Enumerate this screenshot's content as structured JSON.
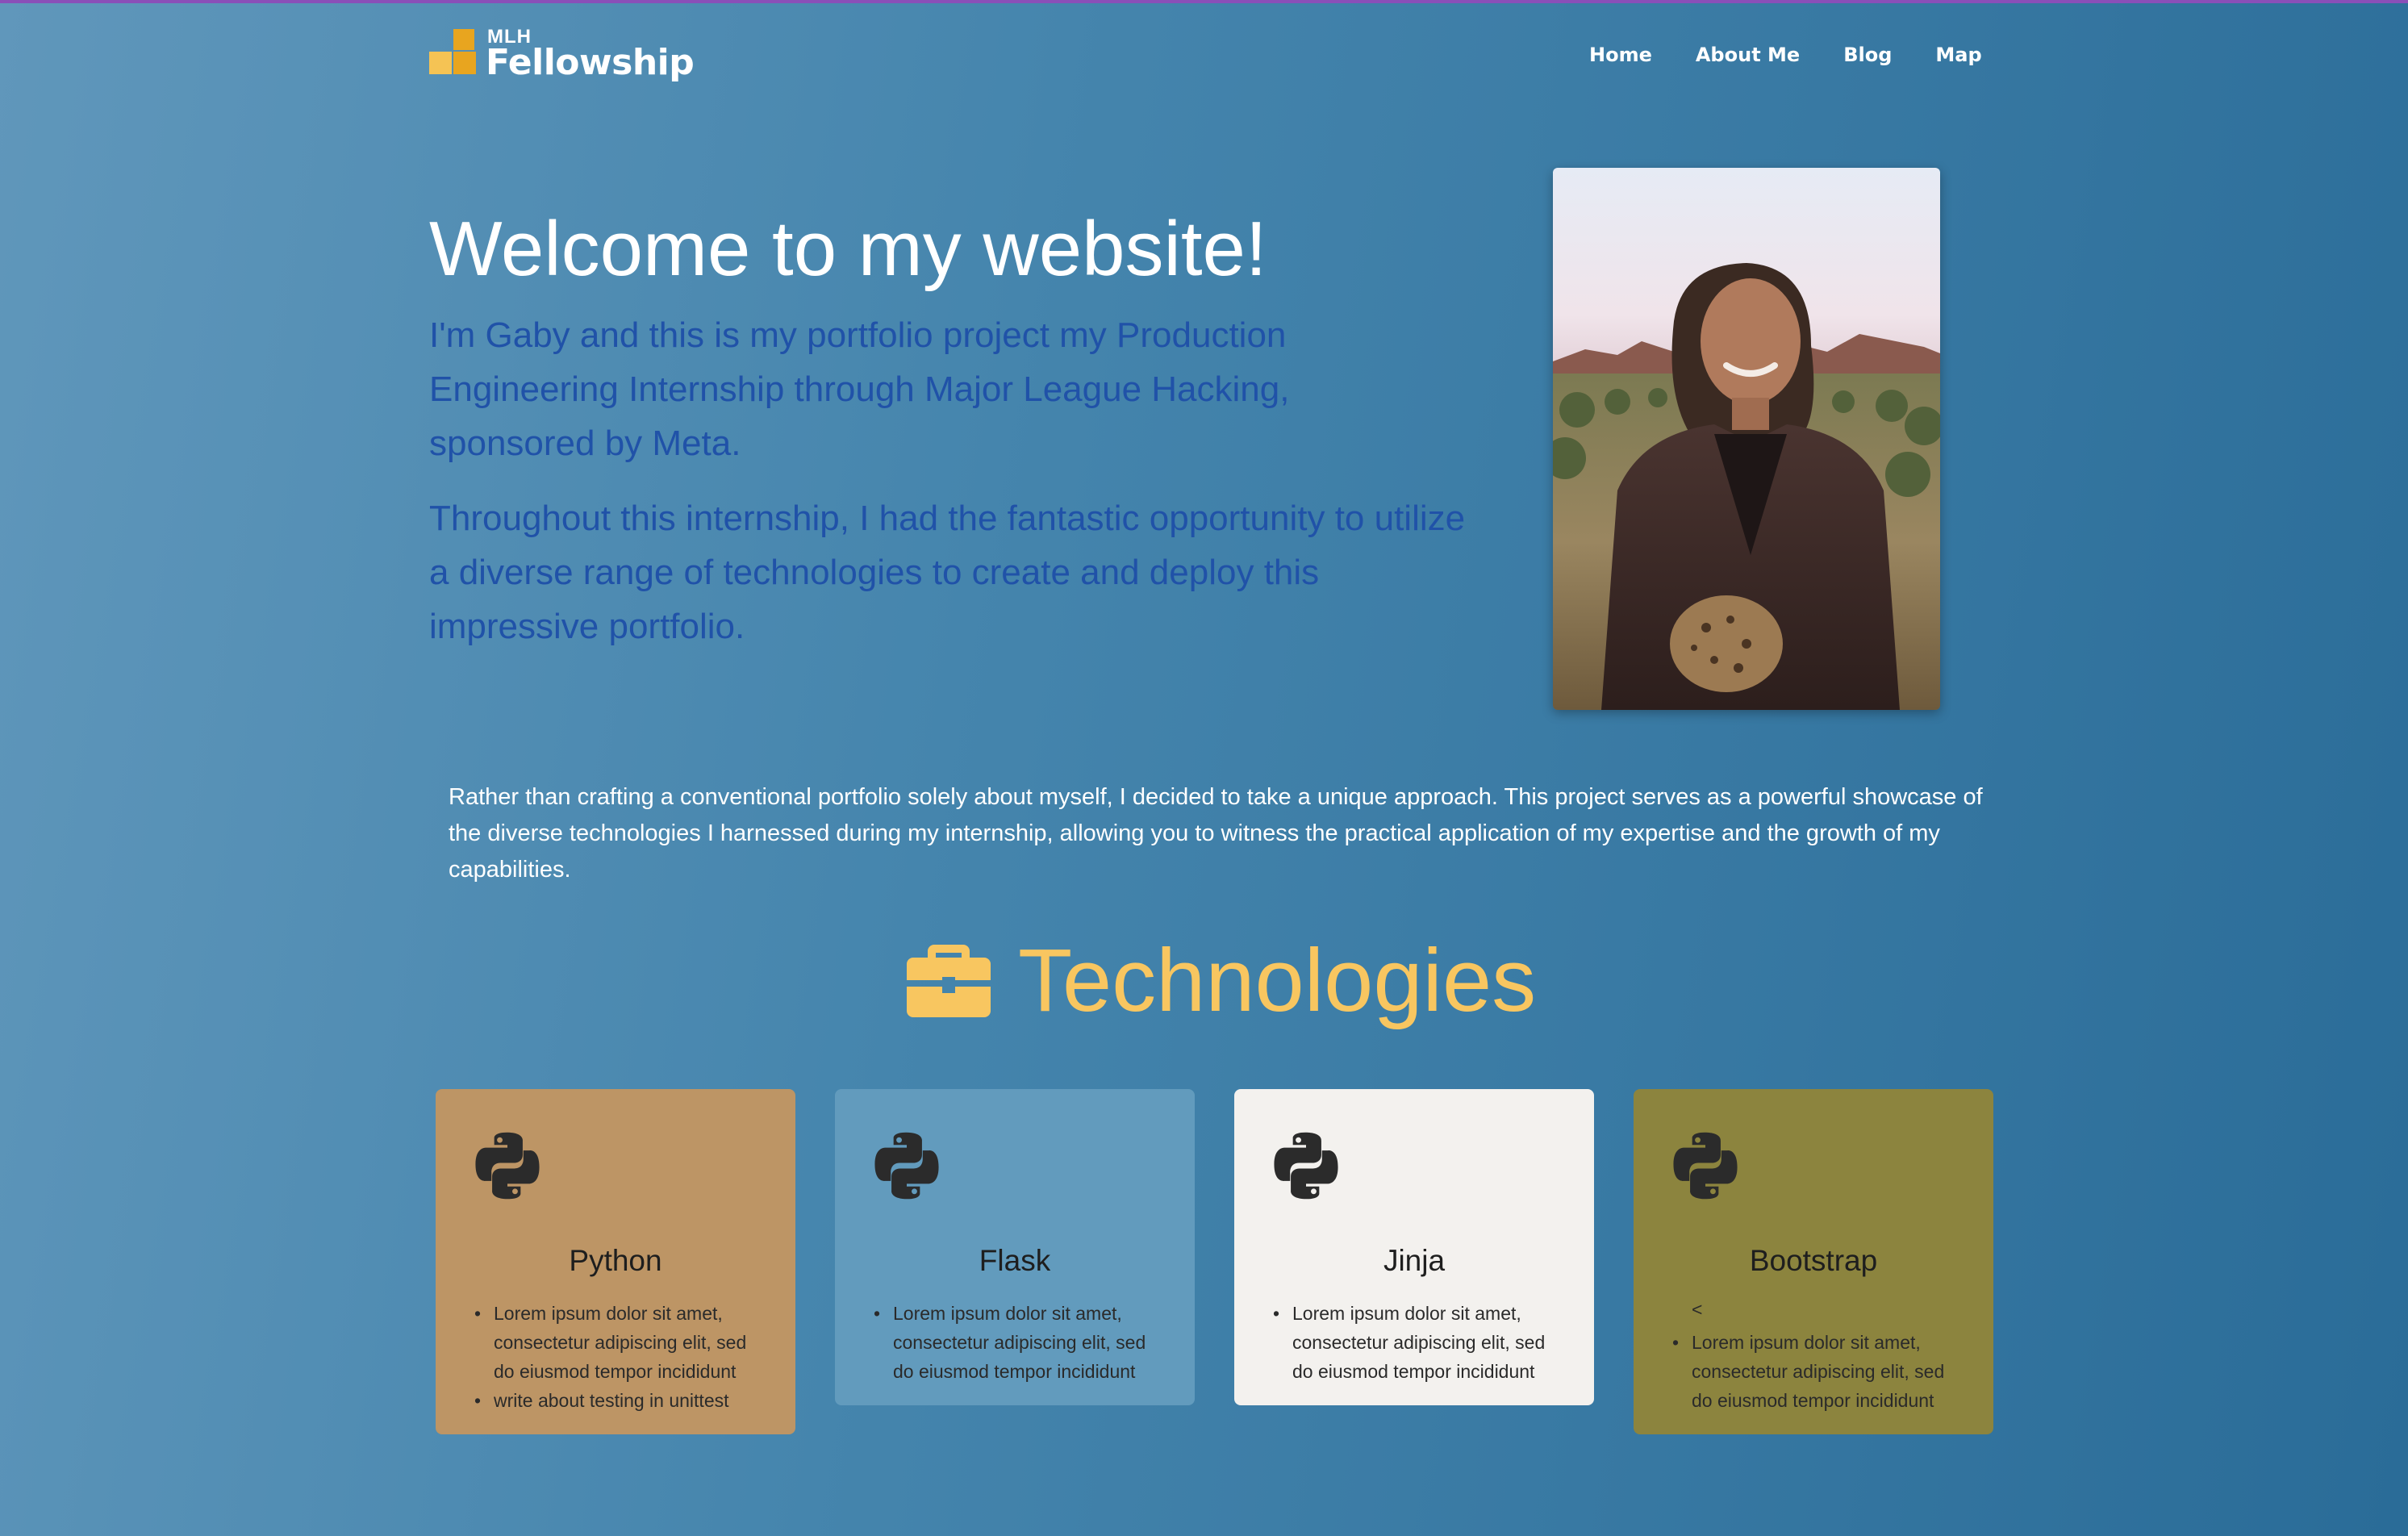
{
  "header": {
    "logo_small": "MLH",
    "logo_large": "Fellowship",
    "nav": [
      {
        "label": "Home"
      },
      {
        "label": "About Me"
      },
      {
        "label": "Blog"
      },
      {
        "label": "Map"
      }
    ]
  },
  "hero": {
    "title": "Welcome to my website!",
    "paragraph1": "I'm Gaby and this is my portfolio project my Production Engineering Internship through Major League Hacking, sponsored by Meta.",
    "paragraph2": "Throughout this internship, I had the fantastic opportunity to utilize a diverse range of technologies to create and deploy this impressive portfolio."
  },
  "intro": "Rather than crafting a conventional portfolio solely about myself, I decided to take a unique approach. This project serves as a powerful showcase of the diverse technologies I harnessed during my internship, allowing you to witness the practical application of my expertise and the growth of my capabilities.",
  "technologies": {
    "heading": "Technologies",
    "heading_icon": "briefcase-icon",
    "cards": [
      {
        "title": "Python",
        "icon": "python-icon",
        "items": [
          "Lorem ipsum dolor sit amet, consectetur adipiscing elit, sed do eiusmod tempor incididunt",
          "write about testing in unittest"
        ]
      },
      {
        "title": "Flask",
        "icon": "python-icon",
        "items": [
          "Lorem ipsum dolor sit amet, consectetur adipiscing elit, sed do eiusmod tempor incididunt"
        ]
      },
      {
        "title": "Jinja",
        "icon": "python-icon",
        "items": [
          "Lorem ipsum dolor sit amet, consectetur adipiscing elit, sed do eiusmod tempor incididunt"
        ]
      },
      {
        "title": "Bootstrap",
        "icon": "python-icon",
        "stray_text": "<",
        "items": [
          "Lorem ipsum dolor sit amet, consectetur adipiscing elit, sed do eiusmod tempor incididunt"
        ]
      }
    ]
  },
  "colors": {
    "accent_yellow": "#f8c660",
    "hero_text_blue": "#2052a8",
    "card_python": "#bd9565",
    "card_flask": "#629bbd",
    "card_jinja": "#f3f1ee",
    "card_bootstrap": "#8c843e"
  }
}
